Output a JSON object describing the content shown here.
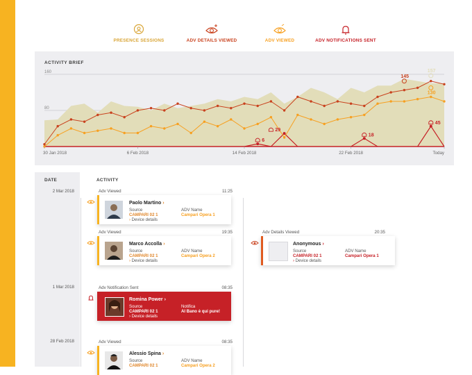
{
  "legend": [
    {
      "label": "PRESENCE SESSIONS",
      "color": "#d9a536",
      "icon": "presence-icon"
    },
    {
      "label": "ADV DETAILS VIEWED",
      "color": "#c9421e",
      "icon": "eye-plus-icon"
    },
    {
      "label": "ADV VIEWED",
      "color": "#f7a021",
      "icon": "eye-icon"
    },
    {
      "label": "ADV NOTIFICATIONS SENT",
      "color": "#c62127",
      "icon": "bell-icon"
    }
  ],
  "activity_brief": {
    "title": "ACTIVITY BRIEF"
  },
  "chart_data": {
    "type": "line",
    "title": "ACTIVITY BRIEF",
    "ylim": [
      0,
      160
    ],
    "yticks": [
      80,
      160
    ],
    "x_tick_labels": [
      "30 Jan 2018",
      "6 Feb 2018",
      "14 Feb 2018",
      "22 Feb 2018",
      "Today"
    ],
    "x": [
      "30 Jan 2018",
      "31 Jan 2018",
      "1 Feb 2018",
      "2 Feb 2018",
      "3 Feb 2018",
      "4 Feb 2018",
      "5 Feb 2018",
      "6 Feb 2018",
      "7 Feb 2018",
      "8 Feb 2018",
      "9 Feb 2018",
      "10 Feb 2018",
      "11 Feb 2018",
      "12 Feb 2018",
      "13 Feb 2018",
      "14 Feb 2018",
      "15 Feb 2018",
      "16 Feb 2018",
      "17 Feb 2018",
      "18 Feb 2018",
      "19 Feb 2018",
      "20 Feb 2018",
      "21 Feb 2018",
      "22 Feb 2018",
      "23 Feb 2018",
      "24 Feb 2018",
      "25 Feb 2018",
      "26 Feb 2018",
      "27 Feb 2018",
      "28 Feb 2018",
      "1 Mar 2018"
    ],
    "series": [
      {
        "name": "Presence Sessions",
        "color": "#e2ddb9",
        "values": [
          58,
          60,
          90,
          95,
          75,
          100,
          90,
          88,
          80,
          95,
          85,
          90,
          95,
          105,
          100,
          110,
          105,
          120,
          95,
          110,
          130,
          120,
          105,
          130,
          120,
          135,
          135,
          150,
          145,
          140,
          140
        ]
      },
      {
        "name": "Adv Details Viewed",
        "color": "#c9421e",
        "values": [
          5,
          45,
          60,
          55,
          70,
          75,
          65,
          80,
          85,
          80,
          95,
          85,
          80,
          90,
          85,
          95,
          90,
          100,
          80,
          110,
          100,
          90,
          100,
          95,
          90,
          110,
          120,
          125,
          130,
          145,
          138
        ]
      },
      {
        "name": "Adv Viewed",
        "color": "#f7a021",
        "values": [
          0,
          25,
          40,
          30,
          35,
          40,
          30,
          30,
          45,
          40,
          50,
          30,
          55,
          45,
          60,
          40,
          50,
          65,
          20,
          70,
          60,
          50,
          60,
          65,
          70,
          95,
          100,
          100,
          105,
          110,
          100
        ]
      },
      {
        "name": "Adv Notifications Sent",
        "color": "#c62127",
        "values": [
          0,
          0,
          0,
          0,
          0,
          0,
          0,
          0,
          0,
          0,
          0,
          0,
          0,
          0,
          0,
          0,
          6,
          0,
          29,
          0,
          0,
          0,
          0,
          0,
          18,
          0,
          0,
          0,
          0,
          45,
          0
        ]
      }
    ],
    "annotations": [
      {
        "x": "15 Feb 2018",
        "label": "6",
        "series": "Adv Notifications Sent",
        "value": 6
      },
      {
        "x": "16 Feb 2018",
        "label": "29",
        "series": "Adv Notifications Sent",
        "value": 29
      },
      {
        "x": "23 Feb 2018",
        "label": "18",
        "series": "Adv Notifications Sent",
        "value": 18
      },
      {
        "x": "28 Feb 2018",
        "label": "45",
        "series": "Adv Notifications Sent",
        "value": 45
      },
      {
        "x": "26 Feb 2018",
        "label": "145",
        "series": "Adv Details Viewed",
        "value": 145
      },
      {
        "x": "28 Feb 2018",
        "label": "157",
        "series": "Presence Sessions",
        "value": 157
      },
      {
        "x": "28 Feb 2018",
        "label": "130",
        "series": "Adv Viewed",
        "value": 130
      }
    ]
  },
  "timeline": {
    "date_header": "DATE",
    "activity_header": "ACTIVITY",
    "dates": [
      "2 Mar 2018",
      "1 Mar 2018",
      "28 Feb 2018"
    ],
    "events": [
      {
        "type": "Adv Viewed",
        "time": "11:25",
        "name": "Paolo Martino",
        "source_label": "Source",
        "source": "CAMPARI 02 1",
        "device": "Device details",
        "adv_label": "ADV Name",
        "adv": "Campari Opera 1"
      },
      {
        "type": "Adv Viewed",
        "time": "19:35",
        "name": "Marco Accolla",
        "source_label": "Source",
        "source": "CAMPARI 02 1",
        "device": "Device details",
        "adv_label": "ADV Name",
        "adv": "Campari Opera  2"
      },
      {
        "type": "Adv Details Viewed",
        "time": "20:35",
        "name": "Anonymous",
        "source_label": "Source",
        "source": "CAMPARI 02 1",
        "device": "Device details",
        "adv_label": "ADV Name",
        "adv": "Campari Opera 1"
      },
      {
        "type": "Adv Notification Sent",
        "time": "08:35",
        "name": "Romina Power",
        "source_label": "Source",
        "source": "CAMPARI 02 1",
        "device": "Device details",
        "adv_label": "Notifica",
        "adv": "Al Bano è qui pure!"
      },
      {
        "type": "Adv Viewed",
        "time": "08:35",
        "name": "Alessio Spina",
        "source_label": "Source",
        "source": "CAMPARI 02 1",
        "device": "",
        "adv_label": "ADV Name",
        "adv": "Campari Opera  2"
      }
    ]
  }
}
